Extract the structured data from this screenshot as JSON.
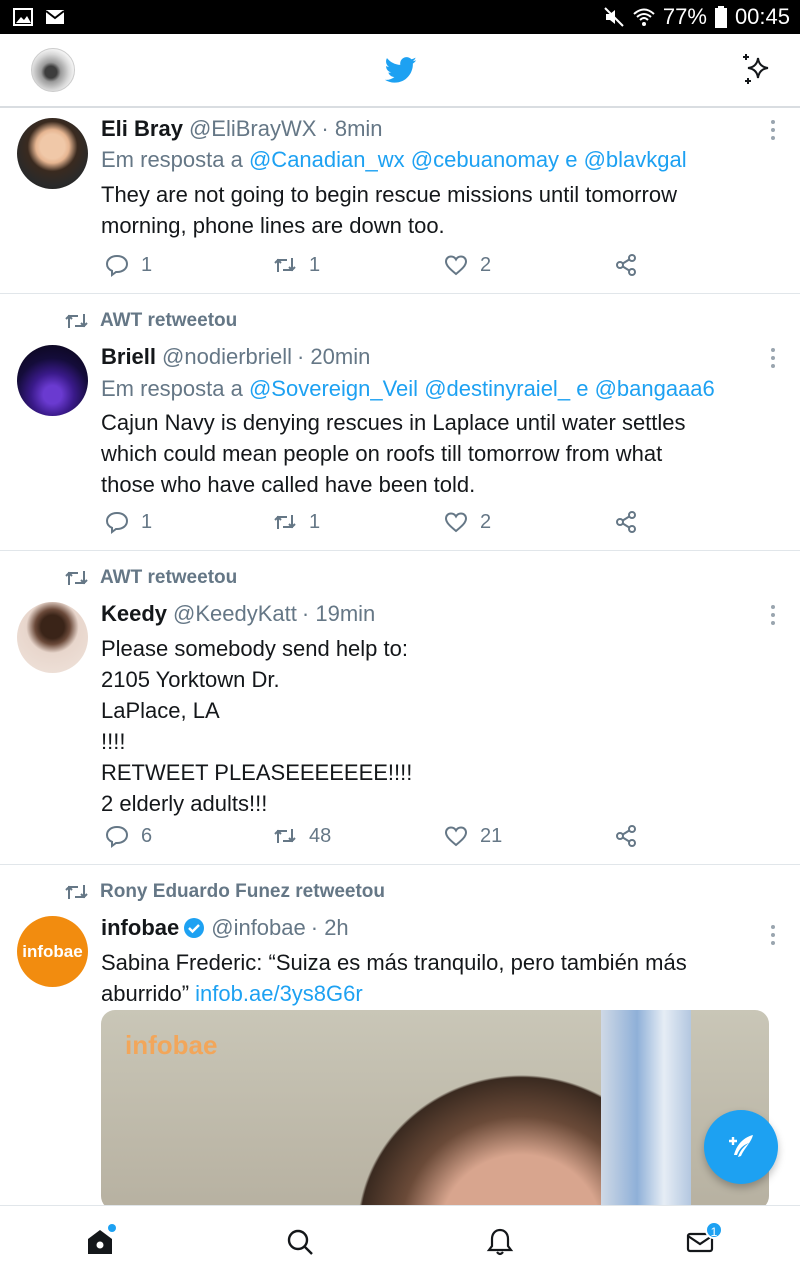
{
  "status_bar": {
    "battery": "77%",
    "time": "00:45"
  },
  "header": {
    "logo": "twitter-bird",
    "sparkle_icon": "sparkle-icon"
  },
  "tweets": [
    {
      "retweeted_by": "",
      "name": "Eli Bray",
      "handle": "@EliBrayWX",
      "time": "· 8min",
      "reply_prefix": "Em resposta a",
      "reply_mentions": [
        "@Canadian_wx",
        "@cebuanomay",
        "e",
        "@blavkgal"
      ],
      "text_lines": [
        "They are not going to begin rescue missions until tomorrow",
        "morning, phone lines are down too."
      ],
      "replies": "1",
      "retweets": "1",
      "likes": "2"
    },
    {
      "retweeted_by": "AWT retweetou",
      "name": "Briell",
      "handle": "@nodierbriell",
      "time": "· 20min",
      "reply_prefix": "Em resposta a",
      "reply_mentions": [
        "@Sovereign_Veil",
        "@destinyraiel_",
        "e",
        "@bangaaa6"
      ],
      "text_lines": [
        "Cajun Navy is denying rescues in Laplace until water settles",
        "which could mean people on roofs till tomorrow from what",
        "those who have called have been told."
      ],
      "replies": "1",
      "retweets": "1",
      "likes": "2"
    },
    {
      "retweeted_by": "AWT retweetou",
      "name": "Keedy",
      "handle": "@KeedyKatt",
      "time": "· 19min",
      "text_lines": [
        "Please somebody send help to:",
        "2105 Yorktown Dr.",
        "LaPlace, LA",
        "!!!!",
        "RETWEET PLEASEEEEEEE!!!!",
        "2 elderly adults!!!"
      ],
      "replies": "6",
      "retweets": "48",
      "likes": "21"
    },
    {
      "retweeted_by": "Rony Eduardo Funez retweetou",
      "name": "infobae",
      "handle": "@infobae",
      "time": "· 2h",
      "avatar_text": "infobae",
      "text_line1": "Sabina Frederic: “Suiza es más tranquilo, pero también más",
      "text_line2": "aburrido”",
      "link": "infob.ae/3ys8G6r",
      "media_watermark": "infobae"
    }
  ],
  "nav": {
    "messages_badge": "1"
  },
  "colors": {
    "accent": "#1da1f2",
    "muted": "#657786"
  }
}
